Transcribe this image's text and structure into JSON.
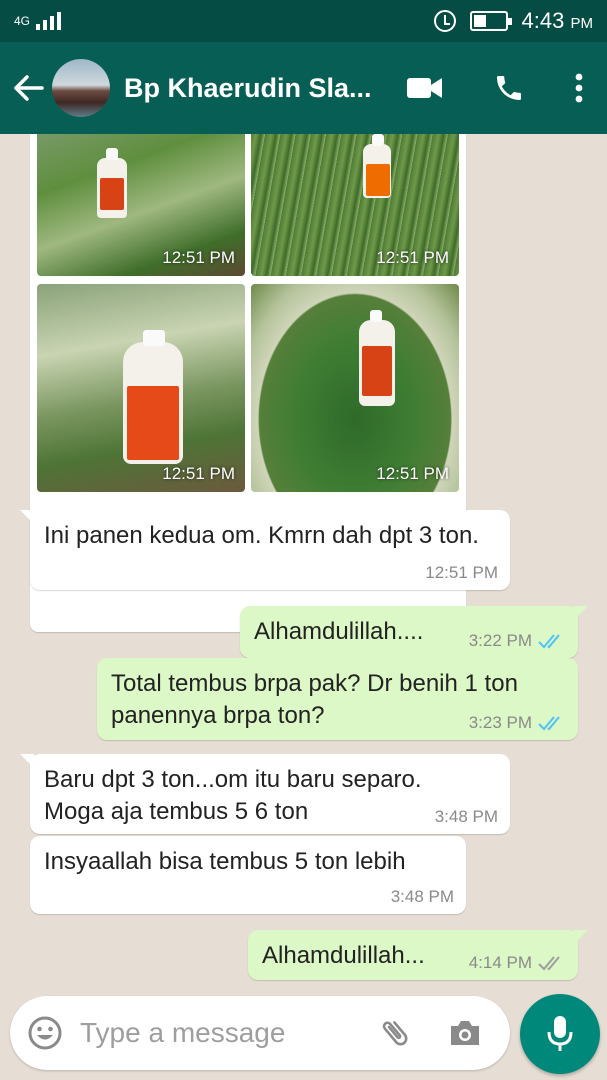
{
  "status_bar": {
    "network": "4G",
    "time": "4:43",
    "ampm": "PM"
  },
  "header": {
    "contact_name": "Bp Khaerudin Sla...",
    "icons": [
      "back-arrow-icon",
      "video-call-icon",
      "phone-icon",
      "more-vert-icon"
    ]
  },
  "photos": [
    {
      "time": "12:51 PM"
    },
    {
      "time": "12:51 PM"
    },
    {
      "time": "12:51 PM"
    },
    {
      "time": "12:51 PM"
    }
  ],
  "messages": [
    {
      "direction": "in",
      "text": "Ini panen kedua om. Kmrn dah dpt 3 ton.",
      "time": "12:51 PM"
    },
    {
      "direction": "out",
      "text": "Alhamdulillah....",
      "time": "3:22 PM",
      "read": true
    },
    {
      "direction": "out",
      "text": "Total tembus brpa pak? Dr benih 1 ton panennya brpa ton?",
      "time": "3:23 PM",
      "read": true
    },
    {
      "direction": "in",
      "text": "Baru dpt 3 ton...om itu baru separo. Moga aja tembus 5 6 ton",
      "time": "3:48 PM"
    },
    {
      "direction": "in",
      "text": "Insyaallah bisa tembus 5 ton lebih",
      "time": "3:48 PM"
    },
    {
      "direction": "out",
      "text": "Alhamdulillah...",
      "time": "4:14 PM",
      "read": false
    }
  ],
  "composer": {
    "placeholder": "Type a message",
    "value": ""
  },
  "colors": {
    "header": "#075e54",
    "status_bar": "#054d44",
    "outgoing_bubble": "#dcf8c6",
    "incoming_bubble": "#ffffff",
    "read_ticks": "#4fc3f7",
    "mic_button": "#00897b"
  }
}
